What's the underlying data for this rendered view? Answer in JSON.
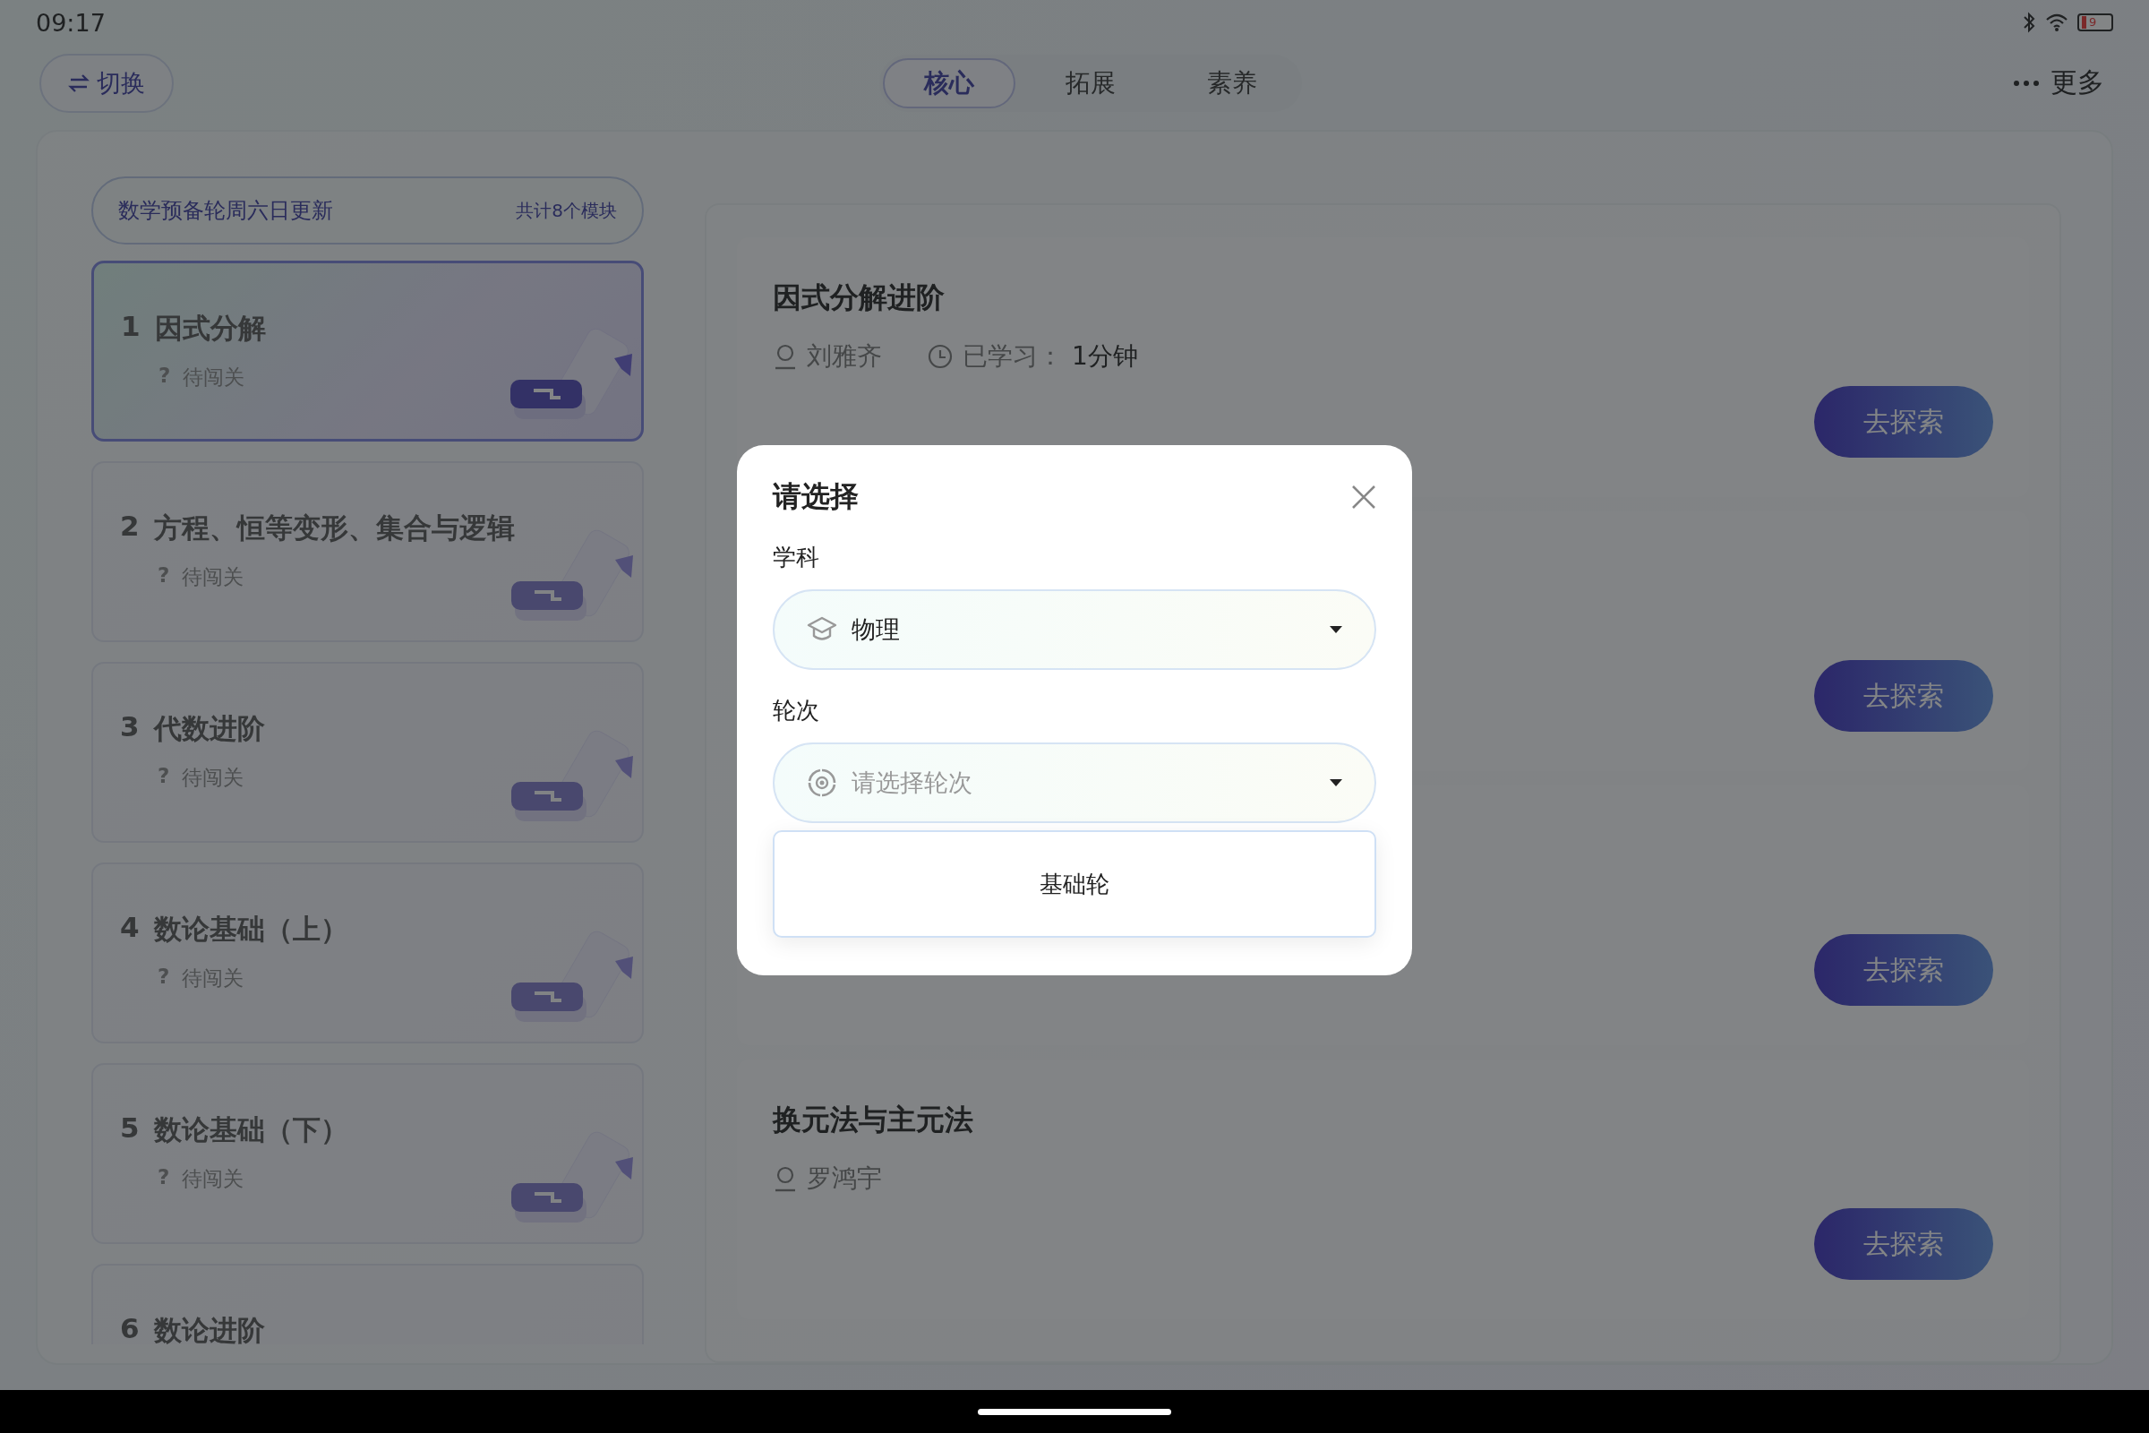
{
  "status_bar": {
    "time": "09:17",
    "battery": "9"
  },
  "top_bar": {
    "switch_button": "切换",
    "tabs": [
      {
        "label": "核心",
        "selected": true
      },
      {
        "label": "拓展",
        "selected": false
      },
      {
        "label": "素养",
        "selected": false
      }
    ],
    "more_button": "更多"
  },
  "module_panel": {
    "header": "数学预备轮周六日更新",
    "count": "共计8个模块",
    "modules": [
      {
        "number": "1",
        "title": "因式分解",
        "status_mark": "?",
        "status": "待闯关",
        "selected": true
      },
      {
        "number": "2",
        "title": "方程、恒等变形、集合与逻辑",
        "status_mark": "?",
        "status": "待闯关",
        "selected": false
      },
      {
        "number": "3",
        "title": "代数进阶",
        "status_mark": "?",
        "status": "待闯关",
        "selected": false
      },
      {
        "number": "4",
        "title": "数论基础（上）",
        "status_mark": "?",
        "status": "待闯关",
        "selected": false
      },
      {
        "number": "5",
        "title": "数论基础（下）",
        "status_mark": "?",
        "status": "待闯关",
        "selected": false
      },
      {
        "number": "6",
        "title": "数论进阶",
        "selected": false
      }
    ]
  },
  "courses": [
    {
      "title": "因式分解进阶",
      "teacher": "刘雅齐",
      "studied_label": "已学习：",
      "studied_value": "1分钟",
      "button": "去探索"
    },
    {
      "button": "去探索"
    },
    {
      "button": "去探索"
    },
    {
      "title": "换元法与主元法",
      "teacher": "罗鸿宇",
      "button": "去探索"
    }
  ],
  "dialog": {
    "title": "请选择",
    "fields": [
      {
        "kind": "subject",
        "label": "学科",
        "value": "物理"
      },
      {
        "kind": "round",
        "label": "轮次",
        "placeholder": "请选择轮次",
        "options": [
          "基础轮"
        ]
      }
    ]
  }
}
